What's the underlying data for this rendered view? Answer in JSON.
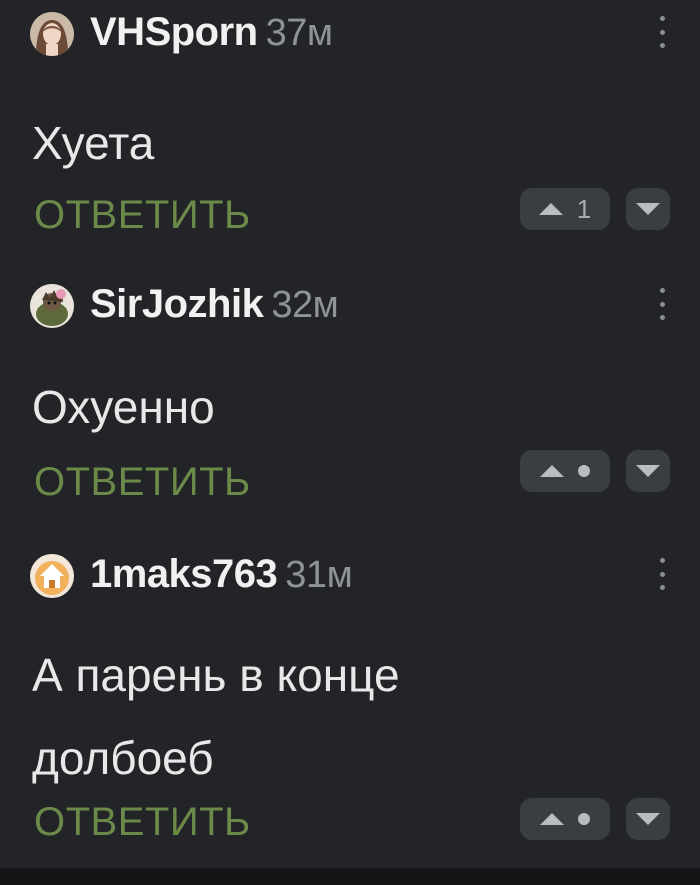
{
  "comments": [
    {
      "username": "VHSporn",
      "time": "37м",
      "text_lines": [
        "Хуета"
      ],
      "reply_label": "ОТВЕТИТЬ",
      "score": "1",
      "avatar_icon": "avatar-girl-portrait"
    },
    {
      "username": "SirJozhik",
      "time": "32м",
      "text_lines": [
        "Охуенно"
      ],
      "reply_label": "ОТВЕТИТЬ",
      "score": "",
      "avatar_icon": "avatar-soldier-hedgehog"
    },
    {
      "username": "1maks763",
      "time": "31м",
      "text_lines": [
        "А парень в конце",
        "долбоеб"
      ],
      "reply_label": "ОТВЕТИТЬ",
      "score": "",
      "avatar_icon": "avatar-cartoon-house"
    }
  ],
  "colors": {
    "background": "#222427",
    "reply_accent": "#6b8a4a",
    "vote_button_bg": "#3a3d41"
  }
}
